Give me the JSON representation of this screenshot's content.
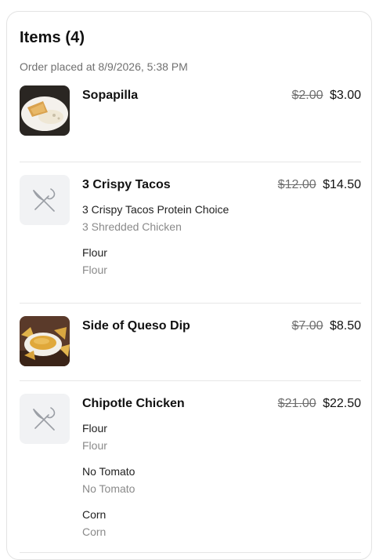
{
  "header": {
    "title": "Items (4)",
    "order_placed": "Order placed at 8/9/2026, 5:38 PM"
  },
  "items": [
    {
      "name": "Sopapilla",
      "original_price": "$2.00",
      "price": "$3.00",
      "image": "photo"
    },
    {
      "name": "3 Crispy Tacos",
      "original_price": "$12.00",
      "price": "$14.50",
      "image": "fork-knife-icon",
      "modifiers": [
        {
          "title": "3 Crispy Tacos Protein Choice",
          "value": "3 Shredded Chicken"
        },
        {
          "title": "Flour",
          "value": "Flour"
        }
      ]
    },
    {
      "name": "Side of Queso Dip",
      "original_price": "$7.00",
      "price": "$8.50",
      "image": "photo"
    },
    {
      "name": "Chipotle Chicken",
      "original_price": "$21.00",
      "price": "$22.50",
      "image": "fork-knife-icon",
      "modifiers": [
        {
          "title": "Flour",
          "value": "Flour"
        },
        {
          "title": "No Tomato",
          "value": "No Tomato"
        },
        {
          "title": "Corn",
          "value": "Corn"
        }
      ]
    }
  ],
  "colors": {
    "placeholder_bg": "#f1f2f4",
    "muted_text": "#707070",
    "divider": "#e6e6e6"
  }
}
